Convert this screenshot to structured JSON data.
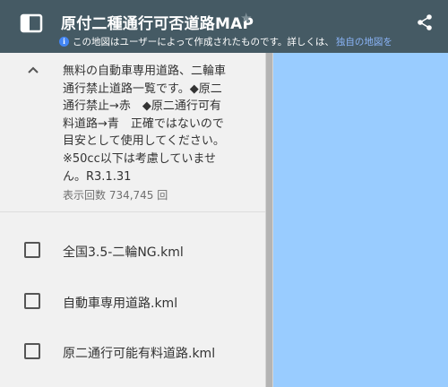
{
  "header": {
    "title": "原付二種通行可否道路MAP",
    "notice": "この地図はユーザーによって作成されたものです。詳しくは、",
    "notice_link": "独自の地図を",
    "bg_color": "#455a64",
    "icons": [
      "sidebar-toggle-icon",
      "star-icon",
      "share-icon",
      "info-icon"
    ]
  },
  "panel": {
    "description_lines": [
      "無料の自動車専用道路、二輪車",
      "通行禁止道路一覧です。◆原二",
      "通行禁止→赤　◆原二通行可有",
      "料道路→青　正確ではないので",
      "目安として使用してください。",
      "※50cc以下は考慮していませ",
      "ん。R3.1.31"
    ],
    "views": "表示回数 734,745 回",
    "layers": [
      {
        "label": "全国3.5-二輪NG.kml",
        "checked": false
      },
      {
        "label": "自動車専用道路.kml",
        "checked": false
      },
      {
        "label": "原二通行可能有料道路.kml",
        "checked": false
      }
    ]
  },
  "map": {
    "bg_color": "#99ccff"
  }
}
